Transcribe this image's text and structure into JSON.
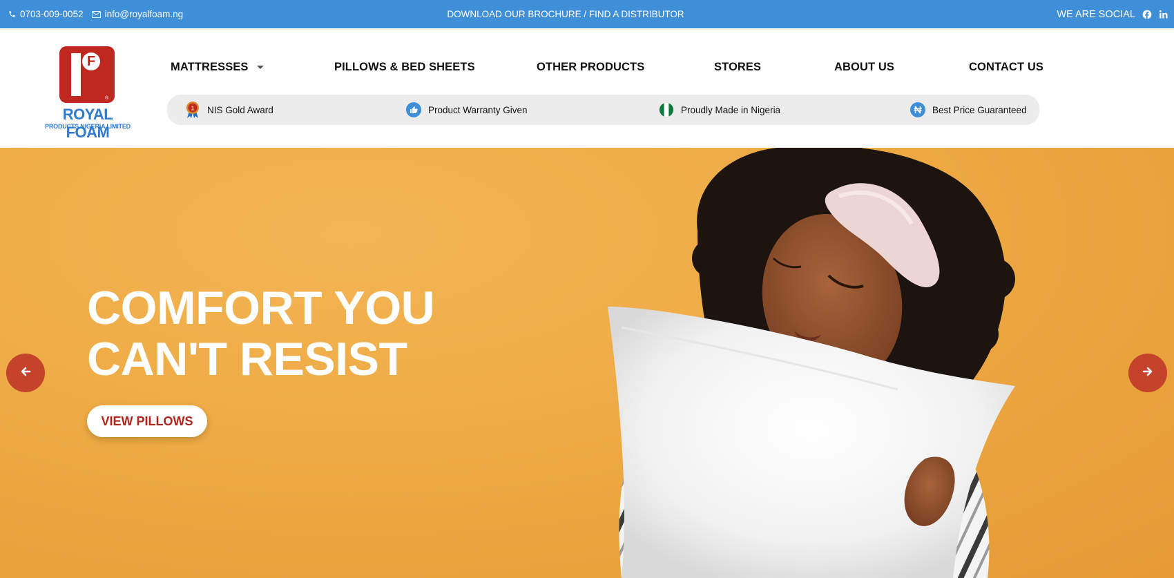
{
  "topbar": {
    "phone": "0703-009-0052",
    "email": "info@royalfoam.ng",
    "center_link": "DOWNLOAD OUR BROCHURE / FIND A DISTRIBUTOR",
    "social_label": "WE ARE SOCIAL",
    "phone_icon": "phone-icon",
    "email_icon": "envelope-icon",
    "social_icons": [
      "facebook-icon",
      "linkedin-icon"
    ],
    "background_color": "#3f8fd8"
  },
  "logo": {
    "mark_letter": "F",
    "brand": "ROYAL FOAM",
    "subtitle": "PRODUCTS NIGERIA LIMITED",
    "brand_color": "#2f7bd0",
    "mark_color": "#c0281f"
  },
  "nav": {
    "items": [
      {
        "label": "MATTRESSES",
        "has_dropdown": true
      },
      {
        "label": "PILLOWS & BED SHEETS"
      },
      {
        "label": "OTHER PRODUCTS"
      },
      {
        "label": "STORES"
      },
      {
        "label": "ABOUT US"
      },
      {
        "label": "CONTACT US"
      }
    ]
  },
  "badges": [
    {
      "label": "NIS Gold Award",
      "icon": "award-medal-icon"
    },
    {
      "label": "Product Warranty Given",
      "icon": "thumbs-up-icon"
    },
    {
      "label": "Proudly Made in Nigeria",
      "icon": "nigeria-flag-icon"
    },
    {
      "label": "Best Price Guaranteed",
      "icon": "naira-icon"
    }
  ],
  "hero": {
    "headline_line1": "COMFORT YOU",
    "headline_line2": "CAN'T RESIST",
    "cta_label": "VIEW PILLOWS",
    "cta_text_color": "#b0241c",
    "background_color": "#eeaa44",
    "arrow_color": "#c4432a",
    "prev_icon": "arrow-left-icon",
    "next_icon": "arrow-right-icon",
    "image": "woman-hugging-pillow-photo"
  }
}
